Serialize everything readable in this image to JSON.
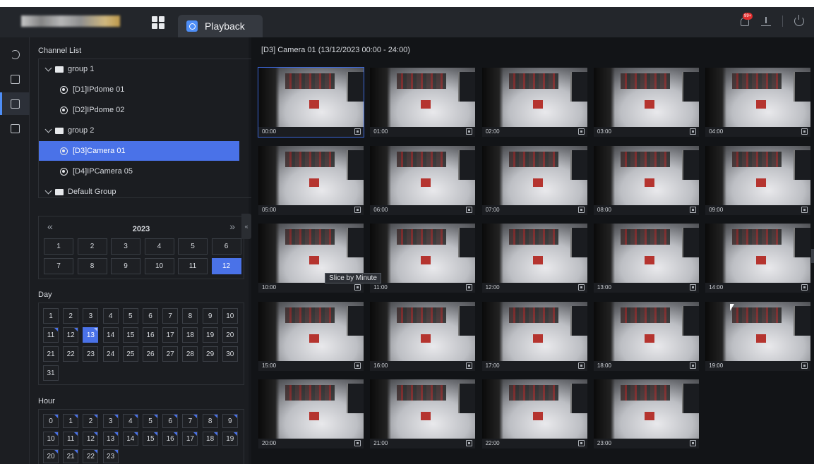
{
  "topbar": {
    "tab_label": "Playback",
    "badge": "99+",
    "icons": [
      "grid-icon",
      "playback-icon",
      "alarm-bell-icon",
      "download-icon",
      "power-icon"
    ]
  },
  "rail": {
    "items": [
      "restore-icon",
      "search-record-icon",
      "playback-icon",
      "layout-icon"
    ],
    "active": 2
  },
  "channel_list": {
    "title": "Channel List",
    "rows": [
      {
        "kind": "group",
        "label": "group 1"
      },
      {
        "kind": "camera",
        "label": "[D1]IPdome 01"
      },
      {
        "kind": "camera",
        "label": "[D2]IPdome 02"
      },
      {
        "kind": "group",
        "label": "group 2"
      },
      {
        "kind": "camera",
        "label": "[D3]Camera 01",
        "selected": true
      },
      {
        "kind": "camera",
        "label": "[D4]IPCamera 05"
      },
      {
        "kind": "group",
        "label": "Default Group"
      }
    ]
  },
  "year_picker": {
    "prev": "«",
    "next": "»",
    "year": "2023",
    "months": [
      "1",
      "2",
      "3",
      "4",
      "5",
      "6",
      "7",
      "8",
      "9",
      "10",
      "11",
      "12"
    ],
    "selected_month": "12"
  },
  "day_picker": {
    "title": "Day",
    "days": [
      "1",
      "2",
      "3",
      "4",
      "5",
      "6",
      "7",
      "8",
      "9",
      "10",
      "11",
      "12",
      "13",
      "14",
      "15",
      "16",
      "17",
      "18",
      "19",
      "20",
      "21",
      "22",
      "23",
      "24",
      "25",
      "26",
      "27",
      "28",
      "29",
      "30",
      "31"
    ],
    "selected_day": "13",
    "recorded_days": [
      "11",
      "12",
      "13"
    ]
  },
  "hour_picker": {
    "title": "Hour",
    "hours": [
      "0",
      "1",
      "2",
      "3",
      "4",
      "5",
      "6",
      "7",
      "8",
      "9",
      "10",
      "11",
      "12",
      "13",
      "14",
      "15",
      "16",
      "17",
      "18",
      "19",
      "20",
      "21",
      "22",
      "23"
    ]
  },
  "main": {
    "title": "[D3] Camera 01 (13/12/2023 00:00 - 24:00)",
    "thumbnails": [
      "00:00",
      "01:00",
      "02:00",
      "03:00",
      "04:00",
      "05:00",
      "06:00",
      "07:00",
      "08:00",
      "09:00",
      "10:00",
      "11:00",
      "12:00",
      "13:00",
      "14:00",
      "15:00",
      "16:00",
      "17:00",
      "18:00",
      "19:00",
      "20:00",
      "21:00",
      "22:00",
      "23:00"
    ],
    "tooltip": "Slice by Minute"
  },
  "colors": {
    "accent": "#4a72e8",
    "background": "#16181c",
    "panel": "#1b1d21"
  }
}
